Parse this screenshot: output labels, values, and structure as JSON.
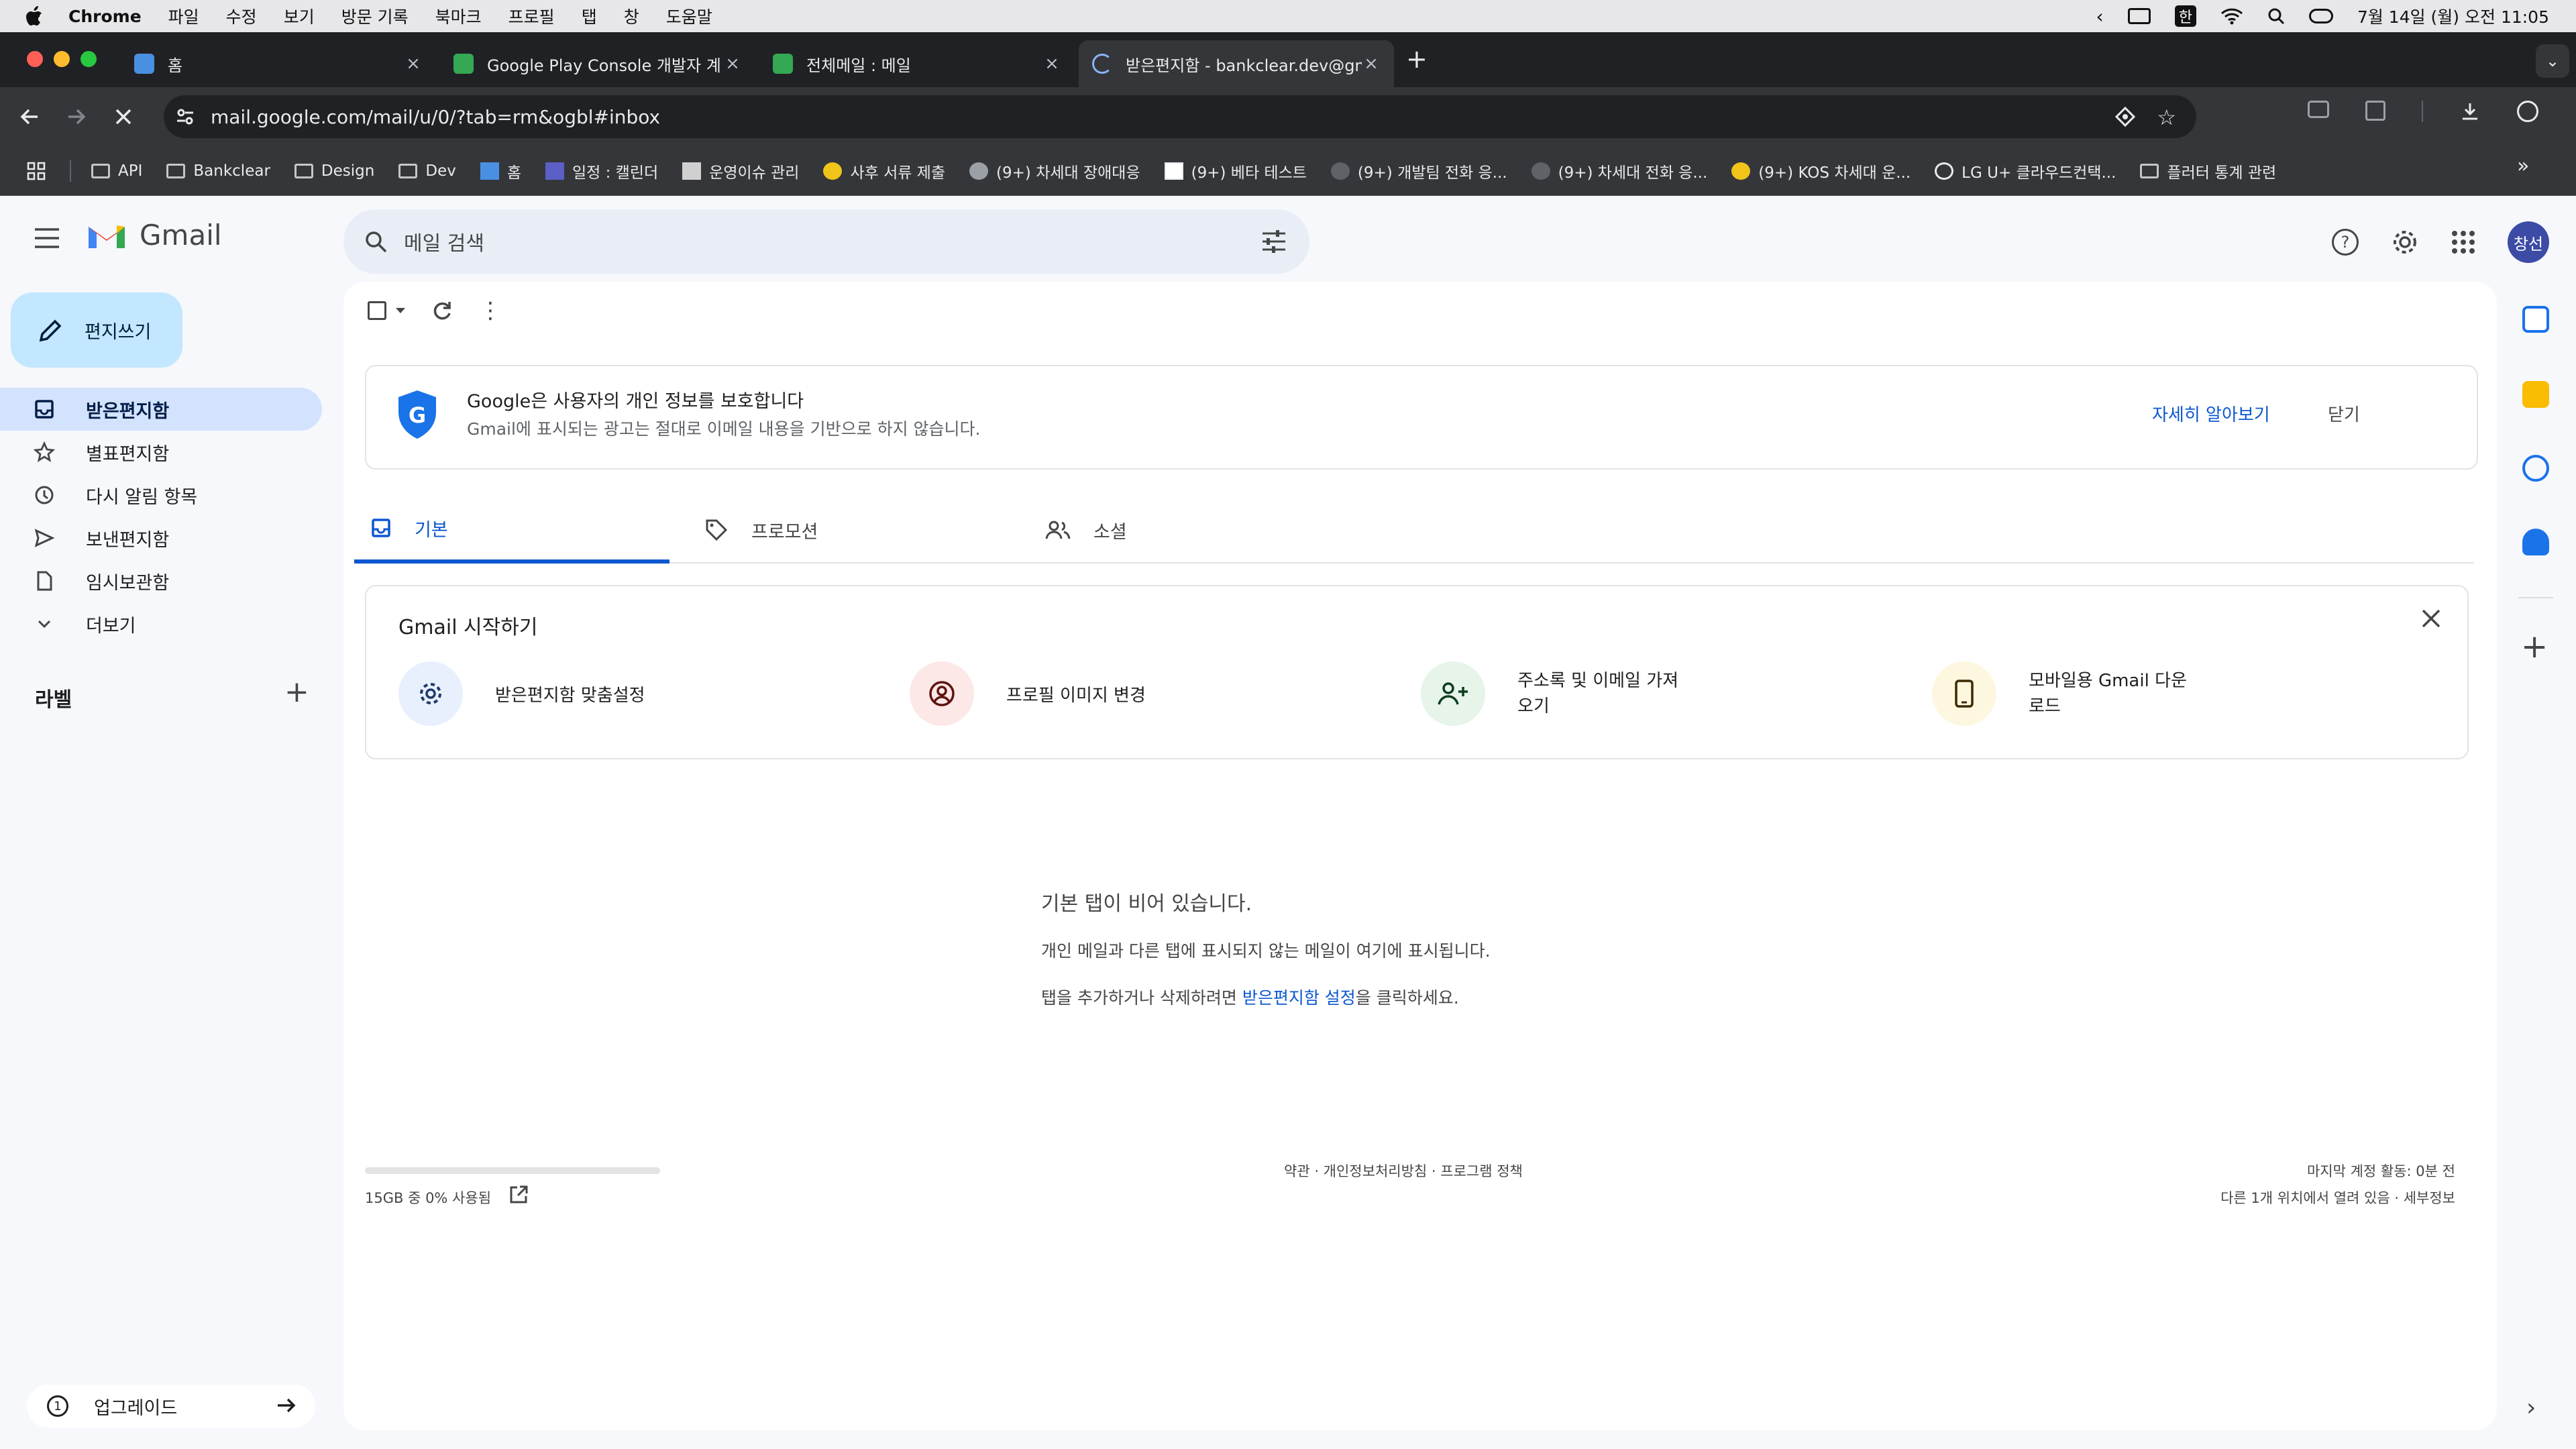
{
  "menubar": {
    "items": [
      "Chrome",
      "파일",
      "수정",
      "보기",
      "방문 기록",
      "북마크",
      "프로필",
      "탭",
      "창",
      "도움말"
    ],
    "ime": "한",
    "clock": "7월 14일 (월) 오전 11:05"
  },
  "browser": {
    "tabs": [
      {
        "title": "홈",
        "active": false
      },
      {
        "title": "Google Play Console 개발자 계",
        "active": false
      },
      {
        "title": "전체메일 : 메일",
        "active": false
      },
      {
        "title": "받은편지함 - bankclear.dev@gm",
        "active": true
      }
    ],
    "url": "mail.google.com/mail/u/0/?tab=rm&ogbl#inbox",
    "bookmarks": [
      {
        "label": "API",
        "icon": "folder-icon"
      },
      {
        "label": "Bankclear",
        "icon": "folder-icon"
      },
      {
        "label": "Design",
        "icon": "folder-icon"
      },
      {
        "label": "Dev",
        "icon": "folder-icon"
      },
      {
        "label": "홈",
        "icon": "page-icon"
      },
      {
        "label": "일정 : 캘린더",
        "icon": "calendar-icon"
      },
      {
        "label": "운영이슈 관리",
        "icon": "page-icon"
      },
      {
        "label": "사후 서류 제출",
        "icon": "page-icon"
      },
      {
        "label": "(9+) 차세대 장애대응",
        "icon": "page-icon"
      },
      {
        "label": "(9+) 베타 테스트",
        "icon": "notion-icon"
      },
      {
        "label": "(9+) 개발팀 전화 응...",
        "icon": "phone-icon"
      },
      {
        "label": "(9+) 차세대 전화 응...",
        "icon": "phone-icon"
      },
      {
        "label": "(9+) KOS 차세대 운...",
        "icon": "page-icon"
      },
      {
        "label": "LG U+ 클라우드컨택...",
        "icon": "globe-icon"
      },
      {
        "label": "플러터 통계 관련",
        "icon": "folder-icon"
      }
    ]
  },
  "gmail": {
    "logo_text": "Gmail",
    "search_placeholder": "메일 검색",
    "compose_label": "편지쓰기",
    "nav": [
      {
        "label": "받은편지함",
        "icon": "inbox-icon",
        "active": true
      },
      {
        "label": "별표편지함",
        "icon": "star-icon",
        "active": false
      },
      {
        "label": "다시 알림 항목",
        "icon": "clock-icon",
        "active": false
      },
      {
        "label": "보낸편지함",
        "icon": "send-icon",
        "active": false
      },
      {
        "label": "임시보관함",
        "icon": "draft-icon",
        "active": false
      },
      {
        "label": "더보기",
        "icon": "chevron-down-icon",
        "active": false
      }
    ],
    "labels_heading": "라벨",
    "upgrade_label": "업그레이드",
    "avatar_text": "창선",
    "privacy_banner": {
      "title": "Google은 사용자의 개인 정보를 보호합니다",
      "body": "Gmail에 표시되는 광고는 절대로 이메일 내용을 기반으로 하지 않습니다.",
      "learn_more": "자세히 알아보기",
      "close": "닫기"
    },
    "category_tabs": [
      {
        "label": "기본",
        "icon": "inbox-icon",
        "active": true
      },
      {
        "label": "프로모션",
        "icon": "tag-icon",
        "active": false
      },
      {
        "label": "소셜",
        "icon": "people-icon",
        "active": false
      }
    ],
    "getting_started": {
      "title": "Gmail 시작하기",
      "items": [
        {
          "label": "받은편지함 맞춤설정",
          "icon": "gear-icon",
          "color": "#e8f0fe"
        },
        {
          "label": "프로필 이미지 변경",
          "icon": "profile-icon",
          "color": "#fce8e6"
        },
        {
          "label_line1": "주소록 및 이메일 가져",
          "label_line2": "오기",
          "icon": "add-person-icon",
          "color": "#e6f4ea"
        },
        {
          "label_line1": "모바일용 Gmail 다운",
          "label_line2": "로드",
          "icon": "phone-icon",
          "color": "#fef7e0"
        }
      ]
    },
    "empty_state": {
      "title": "기본 탭이 비어 있습니다.",
      "line1": "개인 메일과 다른 탭에 표시되지 않는 메일이 여기에 표시됩니다.",
      "line2_prefix": "탭을 추가하거나 삭제하려면 ",
      "line2_link": "받은편지함 설정",
      "line2_suffix": "을 클릭하세요."
    },
    "footer": {
      "storage": "15GB 중 0% 사용됨",
      "storage_used_fraction": 0.0,
      "links": "약관 · 개인정보처리방침 · 프로그램 정책",
      "last_activity": "마지막 계정 활동: 0분 전",
      "sessions": "다른 1개 위치에서 열려 있음 · 세부정보"
    }
  }
}
